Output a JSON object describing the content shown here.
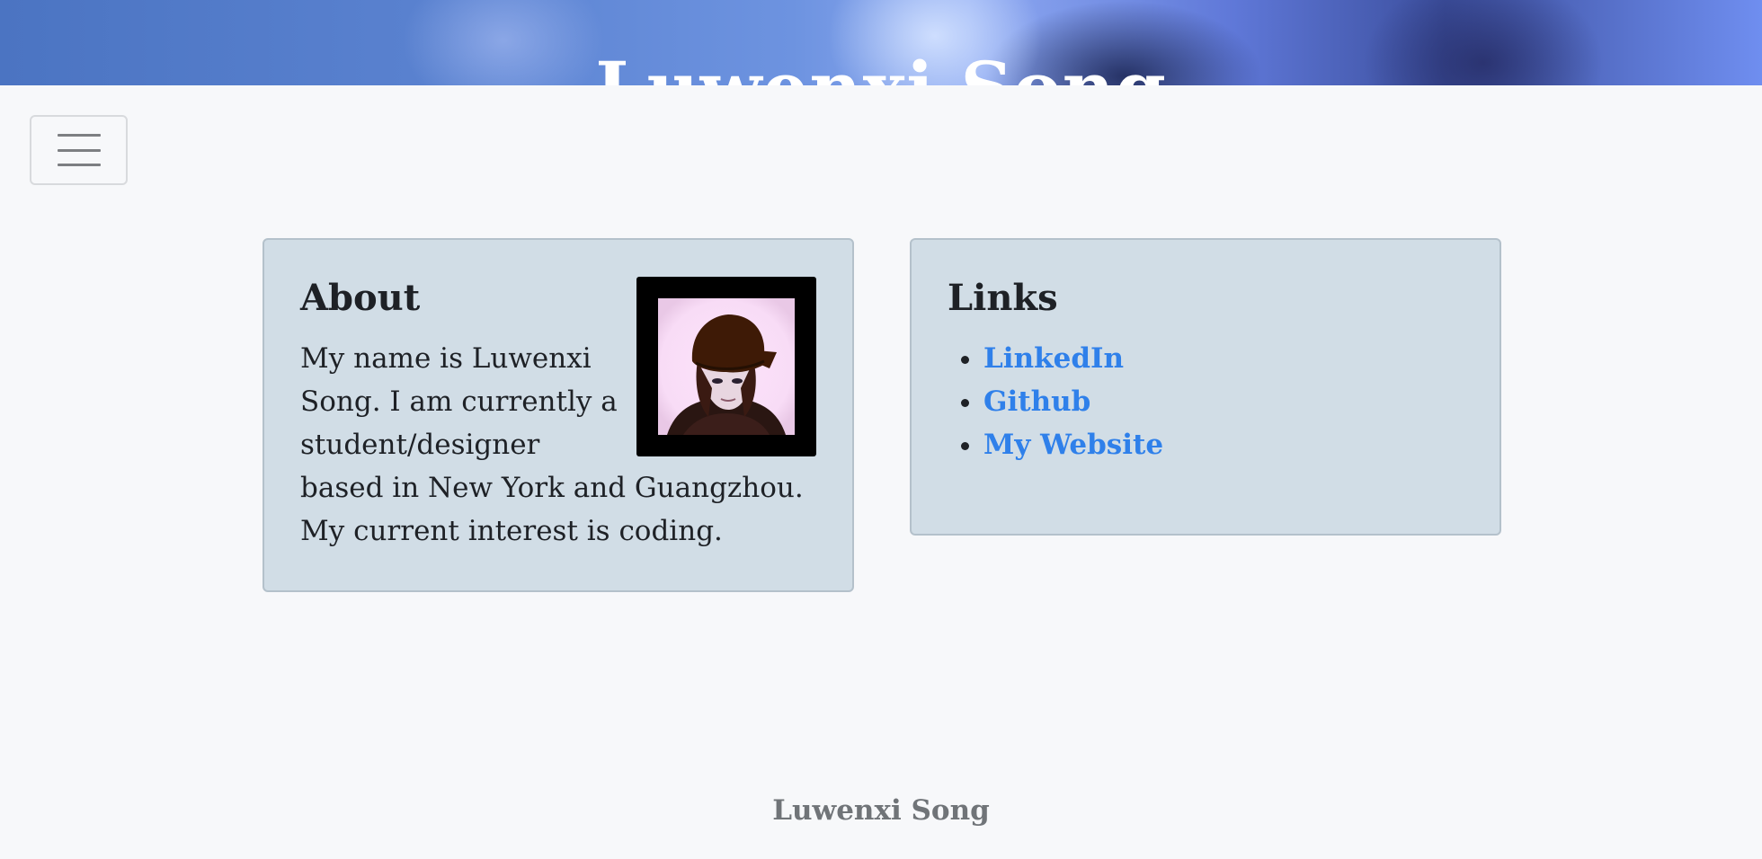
{
  "header": {
    "title": "Luwenxi Song"
  },
  "nav": {
    "toggle_icon": "hamburger-menu-icon"
  },
  "about": {
    "heading": "About",
    "text": "My name is Luwenxi Song. I am currently a student/designer based in New York and Guangzhou. My current interest is coding."
  },
  "links": {
    "heading": "Links",
    "items": [
      {
        "label": "LinkedIn"
      },
      {
        "label": "Github"
      },
      {
        "label": "My Website"
      }
    ]
  },
  "footer": {
    "text": "Luwenxi Song"
  },
  "colors": {
    "card_background": "#d1dde6",
    "link": "#2f80ea",
    "page_background": "#f7f8fa"
  }
}
